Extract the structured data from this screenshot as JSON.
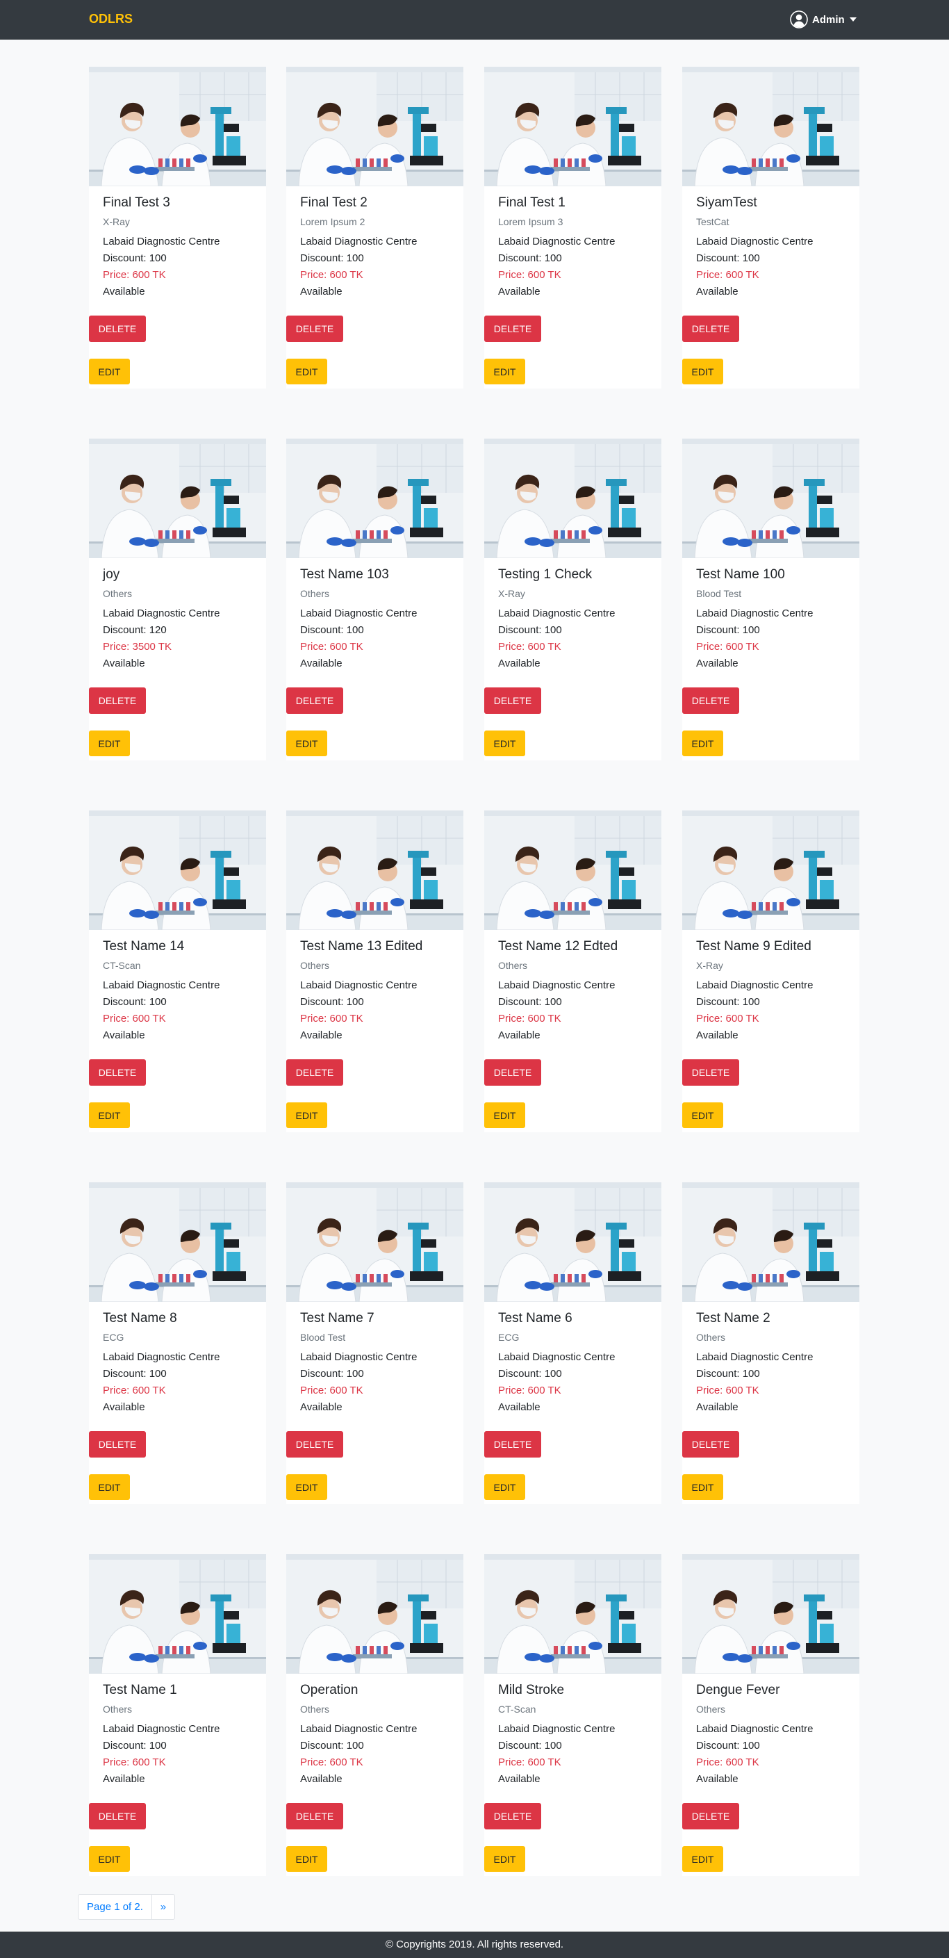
{
  "navbar": {
    "brand": "ODLRS",
    "user_label": "Admin",
    "user_icon": "user-circle-icon",
    "caret_icon": "caret-down-icon",
    "brand_color": "#ffc107",
    "bg_color": "#343a40"
  },
  "card_image_icon": "lab-scientists-photo",
  "cards": [
    {
      "title": "Final Test 3",
      "category": "X-Ray",
      "lab": "Labaid Diagnostic Centre",
      "discount": "Discount: 100",
      "price": "Price: 600 TK",
      "status": "Available",
      "delete_label": "DELETE",
      "edit_label": "EDIT"
    },
    {
      "title": "Final Test 2",
      "category": "Lorem Ipsum 2",
      "lab": "Labaid Diagnostic Centre",
      "discount": "Discount: 100",
      "price": "Price: 600 TK",
      "status": "Available",
      "delete_label": "DELETE",
      "edit_label": "EDIT"
    },
    {
      "title": "Final Test 1",
      "category": "Lorem Ipsum 3",
      "lab": "Labaid Diagnostic Centre",
      "discount": "Discount: 100",
      "price": "Price: 600 TK",
      "status": "Available",
      "delete_label": "DELETE",
      "edit_label": "EDIT"
    },
    {
      "title": "SiyamTest",
      "category": "TestCat",
      "lab": "Labaid Diagnostic Centre",
      "discount": "Discount: 100",
      "price": "Price: 600 TK",
      "status": "Available",
      "delete_label": "DELETE",
      "edit_label": "EDIT"
    },
    {
      "title": "joy",
      "category": "Others",
      "lab": "Labaid Diagnostic Centre",
      "discount": "Discount: 120",
      "price": "Price: 3500 TK",
      "status": "Available",
      "delete_label": "DELETE",
      "edit_label": "EDIT"
    },
    {
      "title": "Test Name 103",
      "category": "Others",
      "lab": "Labaid Diagnostic Centre",
      "discount": "Discount: 100",
      "price": "Price: 600 TK",
      "status": "Available",
      "delete_label": "DELETE",
      "edit_label": "EDIT"
    },
    {
      "title": "Testing 1 Check",
      "category": "X-Ray",
      "lab": "Labaid Diagnostic Centre",
      "discount": "Discount: 100",
      "price": "Price: 600 TK",
      "status": "Available",
      "delete_label": "DELETE",
      "edit_label": "EDIT"
    },
    {
      "title": "Test Name 100",
      "category": "Blood Test",
      "lab": "Labaid Diagnostic Centre",
      "discount": "Discount: 100",
      "price": "Price: 600 TK",
      "status": "Available",
      "delete_label": "DELETE",
      "edit_label": "EDIT"
    },
    {
      "title": "Test Name 14",
      "category": "CT-Scan",
      "lab": "Labaid Diagnostic Centre",
      "discount": "Discount: 100",
      "price": "Price: 600 TK",
      "status": "Available",
      "delete_label": "DELETE",
      "edit_label": "EDIT"
    },
    {
      "title": "Test Name 13 Edited",
      "category": "Others",
      "lab": "Labaid Diagnostic Centre",
      "discount": "Discount: 100",
      "price": "Price: 600 TK",
      "status": "Available",
      "delete_label": "DELETE",
      "edit_label": "EDIT"
    },
    {
      "title": "Test Name 12 Edted",
      "category": "Others",
      "lab": "Labaid Diagnostic Centre",
      "discount": "Discount: 100",
      "price": "Price: 600 TK",
      "status": "Available",
      "delete_label": "DELETE",
      "edit_label": "EDIT"
    },
    {
      "title": "Test Name 9 Edited",
      "category": "X-Ray",
      "lab": "Labaid Diagnostic Centre",
      "discount": "Discount: 100",
      "price": "Price: 600 TK",
      "status": "Available",
      "delete_label": "DELETE",
      "edit_label": "EDIT"
    },
    {
      "title": "Test Name 8",
      "category": "ECG",
      "lab": "Labaid Diagnostic Centre",
      "discount": "Discount: 100",
      "price": "Price: 600 TK",
      "status": "Available",
      "delete_label": "DELETE",
      "edit_label": "EDIT"
    },
    {
      "title": "Test Name 7",
      "category": "Blood Test",
      "lab": "Labaid Diagnostic Centre",
      "discount": "Discount: 100",
      "price": "Price: 600 TK",
      "status": "Available",
      "delete_label": "DELETE",
      "edit_label": "EDIT"
    },
    {
      "title": "Test Name 6",
      "category": "ECG",
      "lab": "Labaid Diagnostic Centre",
      "discount": "Discount: 100",
      "price": "Price: 600 TK",
      "status": "Available",
      "delete_label": "DELETE",
      "edit_label": "EDIT"
    },
    {
      "title": "Test Name 2",
      "category": "Others",
      "lab": "Labaid Diagnostic Centre",
      "discount": "Discount: 100",
      "price": "Price: 600 TK",
      "status": "Available",
      "delete_label": "DELETE",
      "edit_label": "EDIT"
    },
    {
      "title": "Test Name 1",
      "category": "Others",
      "lab": "Labaid Diagnostic Centre",
      "discount": "Discount: 100",
      "price": "Price: 600 TK",
      "status": "Available",
      "delete_label": "DELETE",
      "edit_label": "EDIT"
    },
    {
      "title": "Operation",
      "category": "Others",
      "lab": "Labaid Diagnostic Centre",
      "discount": "Discount: 100",
      "price": "Price: 600 TK",
      "status": "Available",
      "delete_label": "DELETE",
      "edit_label": "EDIT"
    },
    {
      "title": "Mild Stroke",
      "category": "CT-Scan",
      "lab": "Labaid Diagnostic Centre",
      "discount": "Discount: 100",
      "price": "Price: 600 TK",
      "status": "Available",
      "delete_label": "DELETE",
      "edit_label": "EDIT"
    },
    {
      "title": "Dengue Fever",
      "category": "Others",
      "lab": "Labaid Diagnostic Centre",
      "discount": "Discount: 100",
      "price": "Price: 600 TK",
      "status": "Available",
      "delete_label": "DELETE",
      "edit_label": "EDIT"
    }
  ],
  "pagination": {
    "info": "Page 1 of 2.",
    "next_label": "»"
  },
  "footer": {
    "text": "© Copyrights 2019. All rights reserved."
  },
  "colors": {
    "delete": "#dc3545",
    "edit": "#ffc107",
    "price": "#dc3545",
    "link": "#007bff"
  }
}
